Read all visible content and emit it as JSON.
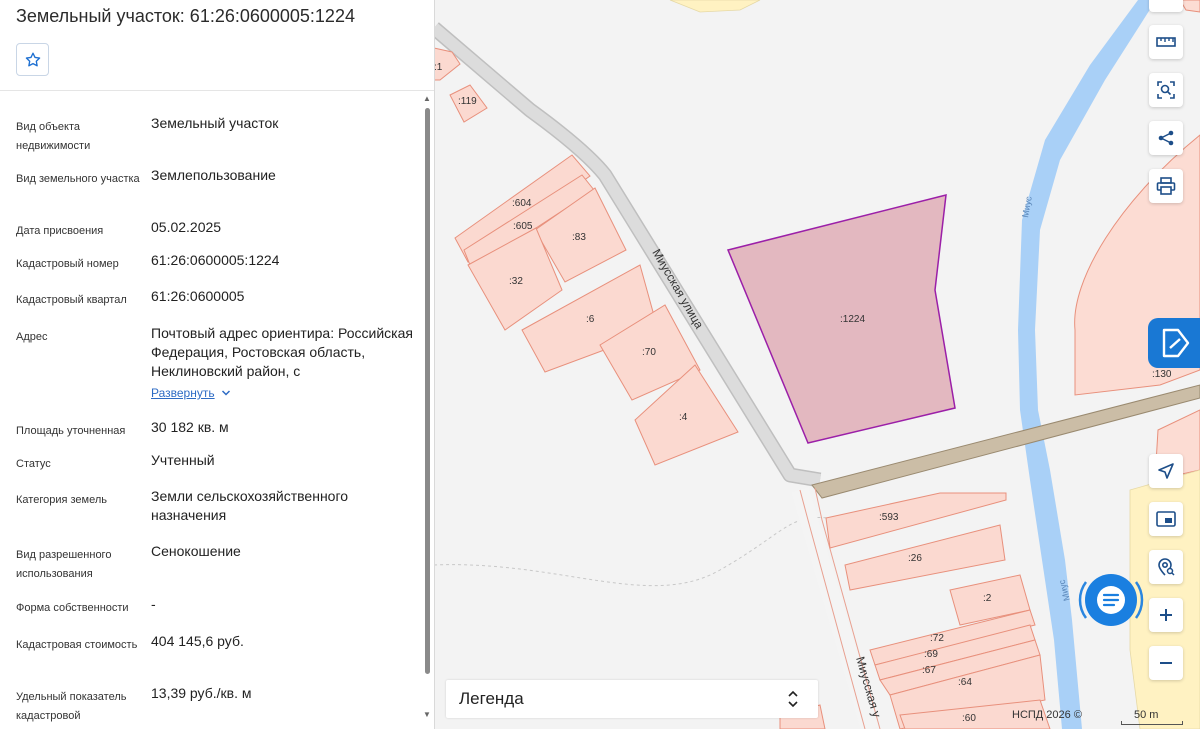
{
  "panel": {
    "title": "Земельный участок: 61:26:0600005:1224",
    "favorite_icon": "star-icon",
    "expand_link": "Развернуть",
    "rows": [
      {
        "label": "Вид объекта недвижимости",
        "value": "Земельный участок"
      },
      {
        "label": "Вид земельного участка",
        "value": "Землепользование"
      },
      {
        "label": "Дата присвоения",
        "value": "05.02.2025"
      },
      {
        "label": "Кадастровый номер",
        "value": "61:26:0600005:1224"
      },
      {
        "label": "Кадастровый квартал",
        "value": "61:26:0600005"
      },
      {
        "label": "Адрес",
        "value": "Почтовый адрес ориентира: Российская Федерация, Ростовская область, Неклиновский район, с"
      },
      {
        "label": "Площадь уточненная",
        "value": "30 182 кв. м"
      },
      {
        "label": "Статус",
        "value": "Учтенный"
      },
      {
        "label": "Категория земель",
        "value": "Земли сельскохозяйственного назначения"
      },
      {
        "label": "Вид разрешенного использования",
        "value": "Сенокошение"
      },
      {
        "label": "Форма собственности",
        "value": "-"
      },
      {
        "label": "Кадастровая стоимость",
        "value": "404 145,6 руб."
      },
      {
        "label": "Удельный показатель кадастровой",
        "value": "13,39 руб./кв. м"
      }
    ]
  },
  "legend": {
    "label": "Легенда"
  },
  "map": {
    "selected_plot": ":1224",
    "street_labels": [
      "Миусская улица",
      "Миусская у"
    ],
    "river_labels": [
      "Миус",
      "Миус"
    ],
    "plot_labels": [
      ":1",
      ":119",
      ":604",
      ":605",
      ":83",
      ":32",
      ":6",
      ":70",
      ":4",
      ":130",
      ":593",
      ":26",
      ":2",
      ":72",
      ":69",
      ":67",
      ":64",
      ":60"
    ],
    "attribution": "НСПД 2026 ©",
    "scale": "50 m"
  },
  "toolbar": {
    "icons": [
      "ruler-icon",
      "area-search-icon",
      "share-icon",
      "print-icon",
      "nspd-logo-icon",
      "locate-arrow-icon",
      "minimap-icon",
      "geo-search-icon",
      "chat-icon",
      "zoom-in-icon",
      "zoom-out-icon"
    ]
  },
  "colors": {
    "selected_fill": "#e3b8c0",
    "selected_stroke": "#9b1fa8",
    "plot_fill": "#fbd9d0",
    "plot_stroke": "#e8907c",
    "river": "#a9d0f7",
    "accent": "#1978d4"
  }
}
